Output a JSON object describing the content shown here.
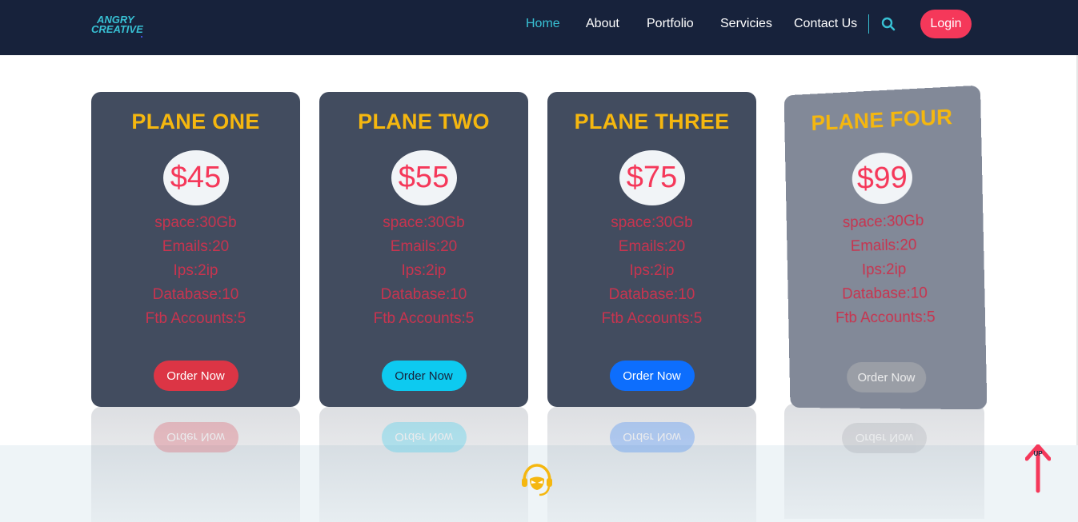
{
  "brand": {
    "logo_line1": "ANGRY",
    "logo_line2": "CREATIVE"
  },
  "nav": {
    "items": [
      {
        "label": "Home",
        "active": true
      },
      {
        "label": "About",
        "active": false
      },
      {
        "label": "Portfolio",
        "active": false
      },
      {
        "label": "Servicies",
        "active": false
      },
      {
        "label": "Contact Us",
        "active": false
      }
    ],
    "search_icon": "search-icon",
    "login_label": "Login"
  },
  "plans": [
    {
      "title": "PLANE ONE",
      "price": "$45",
      "features": [
        "space:30Gb",
        "Emails:20",
        "Ips:2ip",
        "Database:10",
        "Ftb Accounts:5"
      ],
      "order_label": "Order Now",
      "button_color": "#dc3545"
    },
    {
      "title": "PLANE TWO",
      "price": "$55",
      "features": [
        "space:30Gb",
        "Emails:20",
        "Ips:2ip",
        "Database:10",
        "Ftb Accounts:5"
      ],
      "order_label": "Order Now",
      "button_color": "#0dcaf0"
    },
    {
      "title": "PLANE THREE",
      "price": "$75",
      "features": [
        "space:30Gb",
        "Emails:20",
        "Ips:2ip",
        "Database:10",
        "Ftb Accounts:5"
      ],
      "order_label": "Order Now",
      "button_color": "#0d6efd"
    },
    {
      "title": "PLANE FOUR",
      "price": "$99",
      "features": [
        "space:30Gb",
        "Emails:20",
        "Ips:2ip",
        "Database:10",
        "Ftb Accounts:5"
      ],
      "order_label": "Order Now",
      "button_color": "#9a9ea6"
    }
  ],
  "footer": {
    "support_icon": "headset-icon"
  },
  "scroll_top": {
    "label": "UP",
    "icon": "arrow-up-icon"
  },
  "colors": {
    "header_bg": "#17223b",
    "accent": "#38c1d4",
    "login": "#f5385a",
    "plan_title": "#f5b70f",
    "card_bg": "#424c5f",
    "feature_text": "#c8344f"
  }
}
